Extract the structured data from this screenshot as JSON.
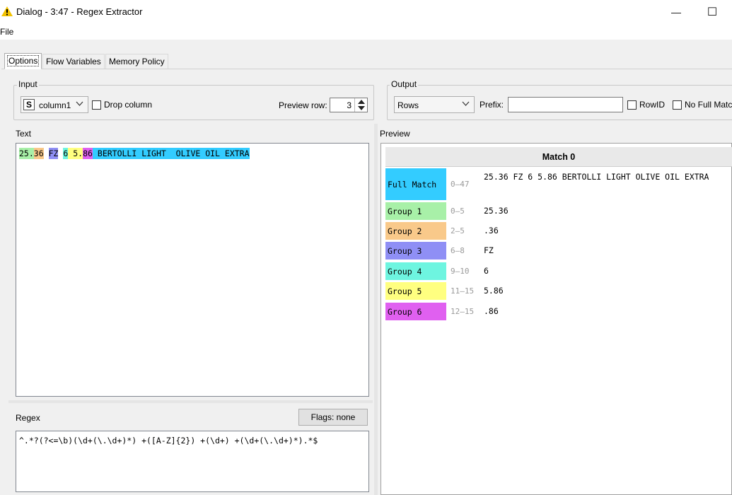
{
  "window": {
    "title": "Dialog - 3:47 - Regex Extractor",
    "minimize_glyph": "—",
    "maximize_glyph": "☐",
    "app_icon": "warning-triangle-icon",
    "app_icon_color": "#f2c200"
  },
  "menu": {
    "file": "File"
  },
  "tabs": [
    {
      "label": "Options"
    },
    {
      "label": "Flow Variables"
    },
    {
      "label": "Memory Policy"
    }
  ],
  "input_group": {
    "legend": "Input",
    "column_type_badge": "S",
    "column_value": "column1",
    "drop_column_label": "Drop column",
    "drop_column_checked": false,
    "preview_row_label": "Preview row:",
    "preview_row_value": "3"
  },
  "output_group": {
    "legend": "Output",
    "output_value": "Rows",
    "prefix_label": "Prefix:",
    "prefix_value": "",
    "rowid_label": "RowID",
    "rowid_checked": false,
    "no_full_match_label": "No Full Matc"
  },
  "text_panel": {
    "label": "Text",
    "segments": [
      {
        "text": "25.",
        "color": "#a8f0a8"
      },
      {
        "text": "36",
        "color": "#f9c98a"
      },
      {
        "text": " ",
        "color": "#ffffff"
      },
      {
        "text": "FZ",
        "color": "#8f8ff5"
      },
      {
        "text": " ",
        "color": "#ffffff"
      },
      {
        "text": "6",
        "color": "#6ef5e0"
      },
      {
        "text": " ",
        "color": "#ffff80"
      },
      {
        "text": "5.",
        "color": "#ffff80"
      },
      {
        "text": "86",
        "color": "#e060f0"
      },
      {
        "text": " BERTOLLI LIGHT  OLIVE OIL EXTRA",
        "color": "#33ccff"
      }
    ]
  },
  "regex_panel": {
    "label": "Regex",
    "flags_button": "Flags: none",
    "pattern": "^.*?(?<=\\b)(\\d+(\\.\\d+)*) +([A-Z]{2}) +(\\d+) +(\\d+(\\.\\d+)*).*$"
  },
  "preview": {
    "label": "Preview",
    "match_header": "Match 0",
    "rows": [
      {
        "label": "Full Match",
        "range": "0–47",
        "value": "25.36 FZ 6 5.86 BERTOLLI LIGHT OLIVE OIL EXTRA",
        "color": "#33ccff"
      },
      {
        "label": "Group 1",
        "range": "0–5",
        "value": "25.36",
        "color": "#a8f0a8"
      },
      {
        "label": "Group 2",
        "range": "2–5",
        "value": ".36",
        "color": "#f9c98a"
      },
      {
        "label": "Group 3",
        "range": "6–8",
        "value": "FZ",
        "color": "#8f8ff5"
      },
      {
        "label": "Group 4",
        "range": "9–10",
        "value": "6",
        "color": "#6ef5e0"
      },
      {
        "label": "Group 5",
        "range": "11–15",
        "value": "5.86",
        "color": "#ffff80"
      },
      {
        "label": "Group 6",
        "range": "12–15",
        "value": ".86",
        "color": "#e060f0"
      }
    ]
  }
}
